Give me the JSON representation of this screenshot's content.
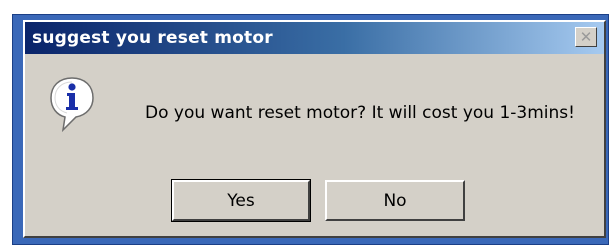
{
  "dialog": {
    "title": "suggest you reset motor",
    "close_glyph": "✕",
    "icon": "information-icon",
    "message": "Do you want reset motor? It will cost you 1-3mins!",
    "buttons": {
      "yes_label": "Yes",
      "no_label": "No"
    }
  },
  "colors": {
    "title_bar_start": "#0a246a",
    "title_bar_end": "#a6caf0",
    "dialog_face": "#d4d0c8",
    "frame_border": "#3a68b8",
    "icon_blue": "#1a2fa8"
  }
}
